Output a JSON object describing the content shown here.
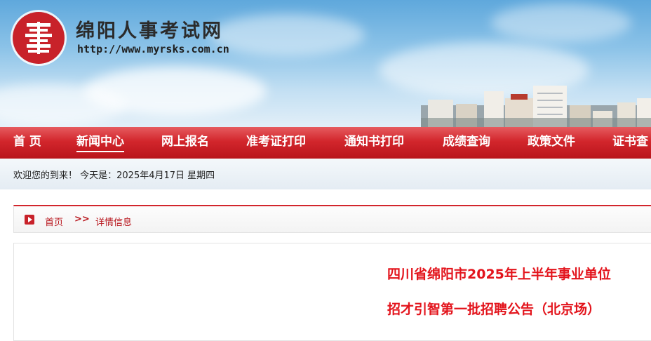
{
  "header": {
    "site_title": "绵阳人事考试网",
    "site_url": "http://www.myrsks.com.cn",
    "logo_icon": "seal-logo-icon",
    "brand_color": "#c8222a"
  },
  "nav": {
    "items": [
      {
        "label": "首 页"
      },
      {
        "label": "新闻中心",
        "active": true
      },
      {
        "label": "网上报名"
      },
      {
        "label": "准考证打印"
      },
      {
        "label": "通知书打印"
      },
      {
        "label": "成绩查询"
      },
      {
        "label": "政策文件"
      },
      {
        "label": "证书查"
      }
    ]
  },
  "welcome": {
    "text": "欢迎您的到来！ 今天是：2025年4月17日 星期四"
  },
  "breadcrumb": {
    "home": "首页",
    "separator": ">>",
    "current": "详情信息",
    "icon": "play-icon"
  },
  "article": {
    "title_line1": "四川省绵阳市2025年上半年事业单位",
    "title_line2": "招才引智第一批招聘公告（北京场）"
  }
}
